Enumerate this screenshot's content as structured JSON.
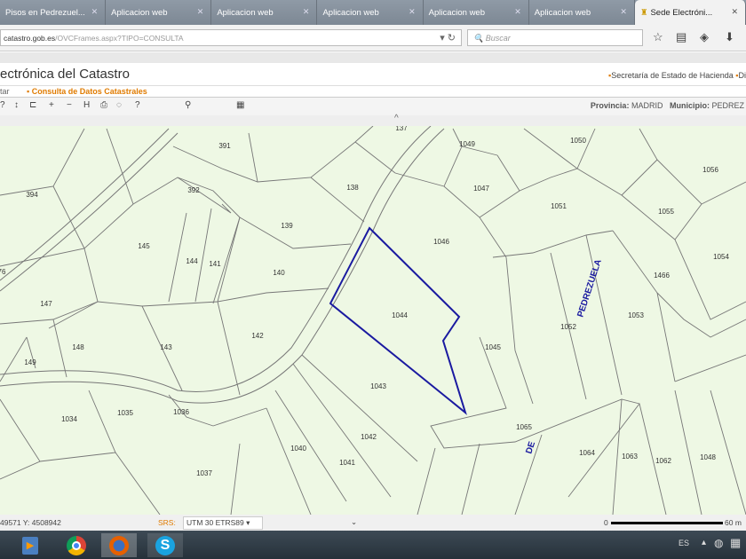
{
  "browser": {
    "tabs": [
      {
        "label": "Pisos en Pedrezuel..."
      },
      {
        "label": "Aplicacion web"
      },
      {
        "label": "Aplicacion web"
      },
      {
        "label": "Aplicacion web"
      },
      {
        "label": "Aplicacion web"
      },
      {
        "label": "Aplicacion web"
      },
      {
        "label": "Sede Electróni...",
        "active": true
      }
    ],
    "url_domain": "catastro.gob.es",
    "url_path": "/OVCFrames.aspx?TIPO=CONSULTA",
    "search_placeholder": "Buscar"
  },
  "site": {
    "title": "ectrónica del Catastro",
    "top_link_1": "Secretaría de Estado de Hacienda",
    "top_link_2": "Di",
    "menu_1": "tar",
    "menu_2": "Consulta de Datos Catastrales"
  },
  "toolbar": {
    "provincia_label": "Provincia:",
    "provincia": "MADRID",
    "municipio_label": "Municipio:",
    "municipio": "PEDREZ"
  },
  "map": {
    "parcels": [
      "391",
      "394",
      "392",
      "138",
      "139",
      "145",
      "144",
      "141",
      "140",
      "147",
      "143",
      "142",
      "148",
      "149",
      "1034",
      "1035",
      "1036",
      "1037",
      "1040",
      "1041",
      "1042",
      "1043",
      "1044",
      "1045",
      "1046",
      "1047",
      "1049",
      "1050",
      "1051",
      "1052",
      "1053",
      "1054",
      "1055",
      "1056",
      "1466",
      "1065",
      "1064",
      "1063",
      "1062",
      "1048",
      "76",
      "137"
    ],
    "selected_parcel": "1044",
    "street_1": "PEDREZUELA",
    "street_2": "DE",
    "highlight_color": "#1a1aa0"
  },
  "status": {
    "coords": "49571 Y: 4508942",
    "srs_label": "SRS:",
    "srs": "UTM 30 ETRS89",
    "scale_start": "0",
    "scale_end": "60 m"
  },
  "taskbar": {
    "lang": "ES"
  }
}
